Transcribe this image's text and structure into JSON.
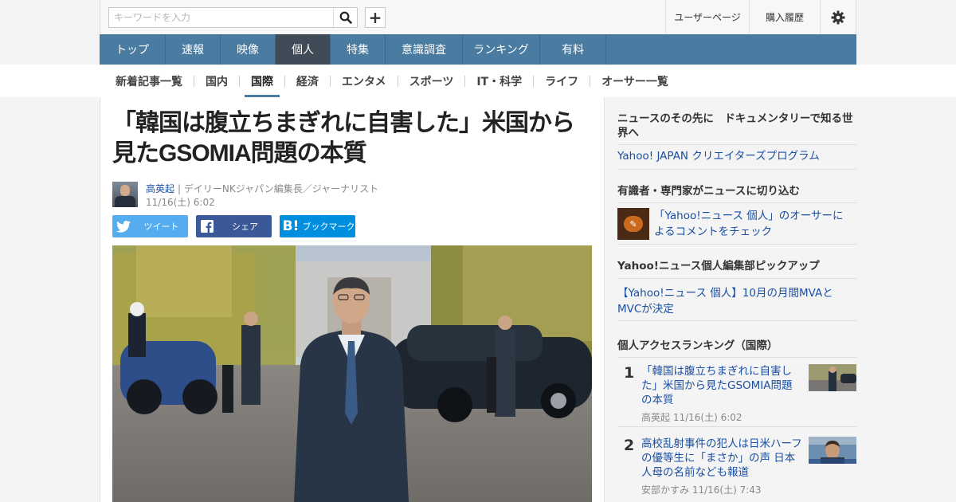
{
  "search": {
    "placeholder": "キーワードを入力"
  },
  "top_links": {
    "user_page": "ユーザーページ",
    "purchase_history": "購入履歴"
  },
  "nav": {
    "items": [
      {
        "label": "トップ"
      },
      {
        "label": "速報"
      },
      {
        "label": "映像"
      },
      {
        "label": "個人"
      },
      {
        "label": "特集"
      },
      {
        "label": "意識調査"
      },
      {
        "label": "ランキング"
      },
      {
        "label": "有料"
      }
    ],
    "active": "個人"
  },
  "subnav": {
    "items": [
      {
        "label": "新着記事一覧"
      },
      {
        "label": "国内"
      },
      {
        "label": "国際"
      },
      {
        "label": "経済"
      },
      {
        "label": "エンタメ"
      },
      {
        "label": "スポーツ"
      },
      {
        "label": "IT・科学"
      },
      {
        "label": "ライフ"
      },
      {
        "label": "オーサー一覧"
      }
    ],
    "active": "国際"
  },
  "article": {
    "title": "「韓国は腹立ちまぎれに自害した」米国から見たGSOMIA問題の本質",
    "author_name": "高英起",
    "author_role": "| デイリーNKジャパン編集長／ジャーナリスト",
    "date": "11/16(土) 6:02",
    "share": {
      "tweet": "ツイート",
      "facebook": "シェア",
      "hatena": "ブックマーク"
    }
  },
  "sidebar": {
    "promo_heading": "ニュースのその先に　ドキュメンタリーで知る世界へ",
    "promo_link": "Yahoo! JAPAN クリエイターズプログラム",
    "experts_heading": "有識者・専門家がニュースに切り込む",
    "experts_link": "「Yahoo!ニュース 個人」のオーサーによるコメントをチェック",
    "pickup_heading": "Yahoo!ニュース個人編集部ピックアップ",
    "pickup_link": "【Yahoo!ニュース 個人】10月の月間MVAとMVCが決定",
    "ranking_heading": "個人アクセスランキング（国際）",
    "ranking": [
      {
        "rank": "1",
        "title": "「韓国は腹立ちまぎれに自害した」米国から見たGSOMIA問題の本質",
        "author": "高英起",
        "date": "11/16(土) 6:02"
      },
      {
        "rank": "2",
        "title": "高校乱射事件の犯人は日米ハーフの優等生に「まさか」の声 日本人母の名前なども報道",
        "author": "安部かすみ",
        "date": "11/16(土) 7:43"
      }
    ]
  },
  "colors": {
    "nav_bg": "#4a7ba0",
    "nav_active": "#3f4b57",
    "link": "#1a4fa3",
    "twitter": "#55acee",
    "facebook": "#3b5998",
    "hatena": "#008fde"
  }
}
